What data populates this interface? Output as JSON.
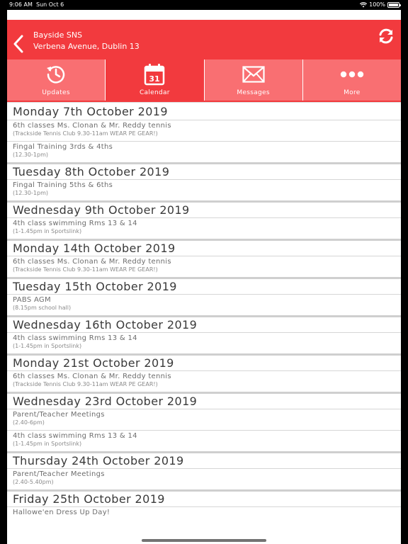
{
  "status_bar": {
    "time": "9:06 AM",
    "date": "Sun Oct 6",
    "battery": "100%"
  },
  "header": {
    "school_name": "Bayside SNS",
    "address": "Verbena Avenue, Dublin 13"
  },
  "tabs": [
    {
      "label": "Updates",
      "icon": "clock-refresh-icon",
      "active": false
    },
    {
      "label": "Calendar",
      "icon": "calendar-icon",
      "calendar_day": "31",
      "active": true
    },
    {
      "label": "Messages",
      "icon": "envelope-icon",
      "active": false
    },
    {
      "label": "More",
      "icon": "more-dots-icon",
      "active": false
    }
  ],
  "days": [
    {
      "date": "Monday 7th October 2019",
      "events": [
        {
          "title": "6th classes Ms. Clonan & Mr. Reddy tennis",
          "detail": "(Trackside Tennis Club 9.30-11am WEAR PE GEAR!)"
        },
        {
          "title": "Fingal Training 3rds & 4ths",
          "detail": "(12.30-1pm)"
        }
      ]
    },
    {
      "date": "Tuesday 8th October 2019",
      "events": [
        {
          "title": "Fingal Training 5ths & 6ths",
          "detail": "(12.30-1pm)"
        }
      ]
    },
    {
      "date": "Wednesday 9th October 2019",
      "events": [
        {
          "title": "4th class swimming Rms 13 & 14",
          "detail": "(1-1.45pm in Sportslink)"
        }
      ]
    },
    {
      "date": "Monday 14th October 2019",
      "events": [
        {
          "title": "6th classes Ms. Clonan & Mr. Reddy tennis",
          "detail": "(Trackside Tennis Club 9.30-11am WEAR PE GEAR!)"
        }
      ]
    },
    {
      "date": "Tuesday 15th October 2019",
      "events": [
        {
          "title": "PABS AGM",
          "detail": "(8.15pm school hall)"
        }
      ]
    },
    {
      "date": "Wednesday 16th October 2019",
      "events": [
        {
          "title": "4th class swimming Rms 13 & 14",
          "detail": "(1-1.45pm in Sportslink)"
        }
      ]
    },
    {
      "date": "Monday 21st October 2019",
      "events": [
        {
          "title": "6th classes Ms. Clonan & Mr. Reddy tennis",
          "detail": "(Trackside Tennis Club 9.30-11am WEAR PE GEAR!)"
        }
      ]
    },
    {
      "date": "Wednesday 23rd October 2019",
      "events": [
        {
          "title": "Parent/Teacher Meetings",
          "detail": "(2.40-6pm)"
        },
        {
          "title": "4th class swimming Rms 13 & 14",
          "detail": "(1-1.45pm in Sportslink)"
        }
      ]
    },
    {
      "date": "Thursday 24th October 2019",
      "events": [
        {
          "title": "Parent/Teacher Meetings",
          "detail": "(2.40-5.40pm)"
        }
      ]
    },
    {
      "date": "Friday 25th October 2019",
      "events": [
        {
          "title": "Hallowe'en Dress Up Day!",
          "detail": ""
        }
      ]
    }
  ]
}
